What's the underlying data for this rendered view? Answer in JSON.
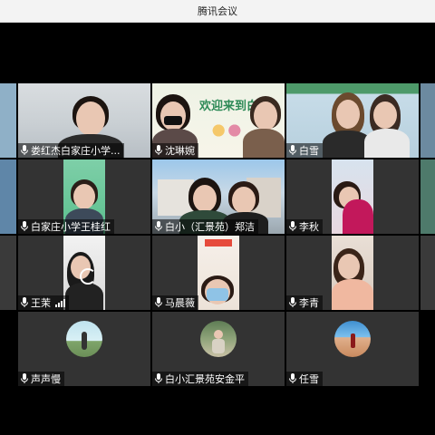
{
  "window": {
    "title": "腾讯会议"
  },
  "participants": [
    {
      "name": "娄红杰白家庄小学..."
    },
    {
      "name": "沈琳婉"
    },
    {
      "name": "白雪"
    },
    {
      "name": "白家庄小学王桂红"
    },
    {
      "name": "白小（汇景苑）郑洁"
    },
    {
      "name": "李秋"
    },
    {
      "name": "王茉"
    },
    {
      "name": "马晨薇"
    },
    {
      "name": "李青"
    },
    {
      "name": "声声慢"
    },
    {
      "name": "白小汇景苑安金平"
    },
    {
      "name": "任雪"
    }
  ],
  "banner": {
    "text": "欢迎来到白小"
  },
  "colors": {
    "titlebar_bg": "#f3f3f3",
    "stage_bg": "#000000",
    "tile_bg": "#333333"
  }
}
